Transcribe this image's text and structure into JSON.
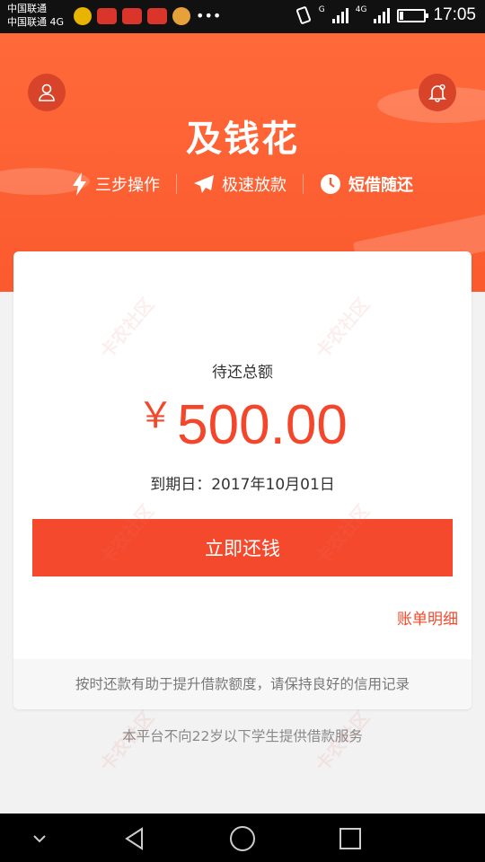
{
  "status_bar": {
    "carrier_1": "中国联通",
    "carrier_2": "中国联通 4G",
    "network_badge_1": "G",
    "network_badge_2": "4G",
    "time": "17:05",
    "battery_level": 0.15
  },
  "header": {
    "logo_text": "及钱花",
    "features": [
      {
        "label": "三步操作",
        "icon": "lightning-icon"
      },
      {
        "label": "极速放款",
        "icon": "paper-plane-icon"
      },
      {
        "label": "短借随还",
        "icon": "clock-icon"
      }
    ],
    "colors": {
      "accent": "#fb5a2e"
    }
  },
  "card": {
    "label": "待还总额",
    "currency": "￥",
    "amount": "500.00",
    "due_date": "到期日：2017年10月01日",
    "repay_button": "立即还钱",
    "detail_link": "账单明细",
    "footer": "按时还款有助于提升借款额度，请保持良好的信用记录"
  },
  "notice": "本平台不向22岁以下学生提供借款服务",
  "navbar": {
    "icons": [
      "chevron-down-icon",
      "back-icon",
      "home-icon",
      "recents-icon"
    ]
  }
}
